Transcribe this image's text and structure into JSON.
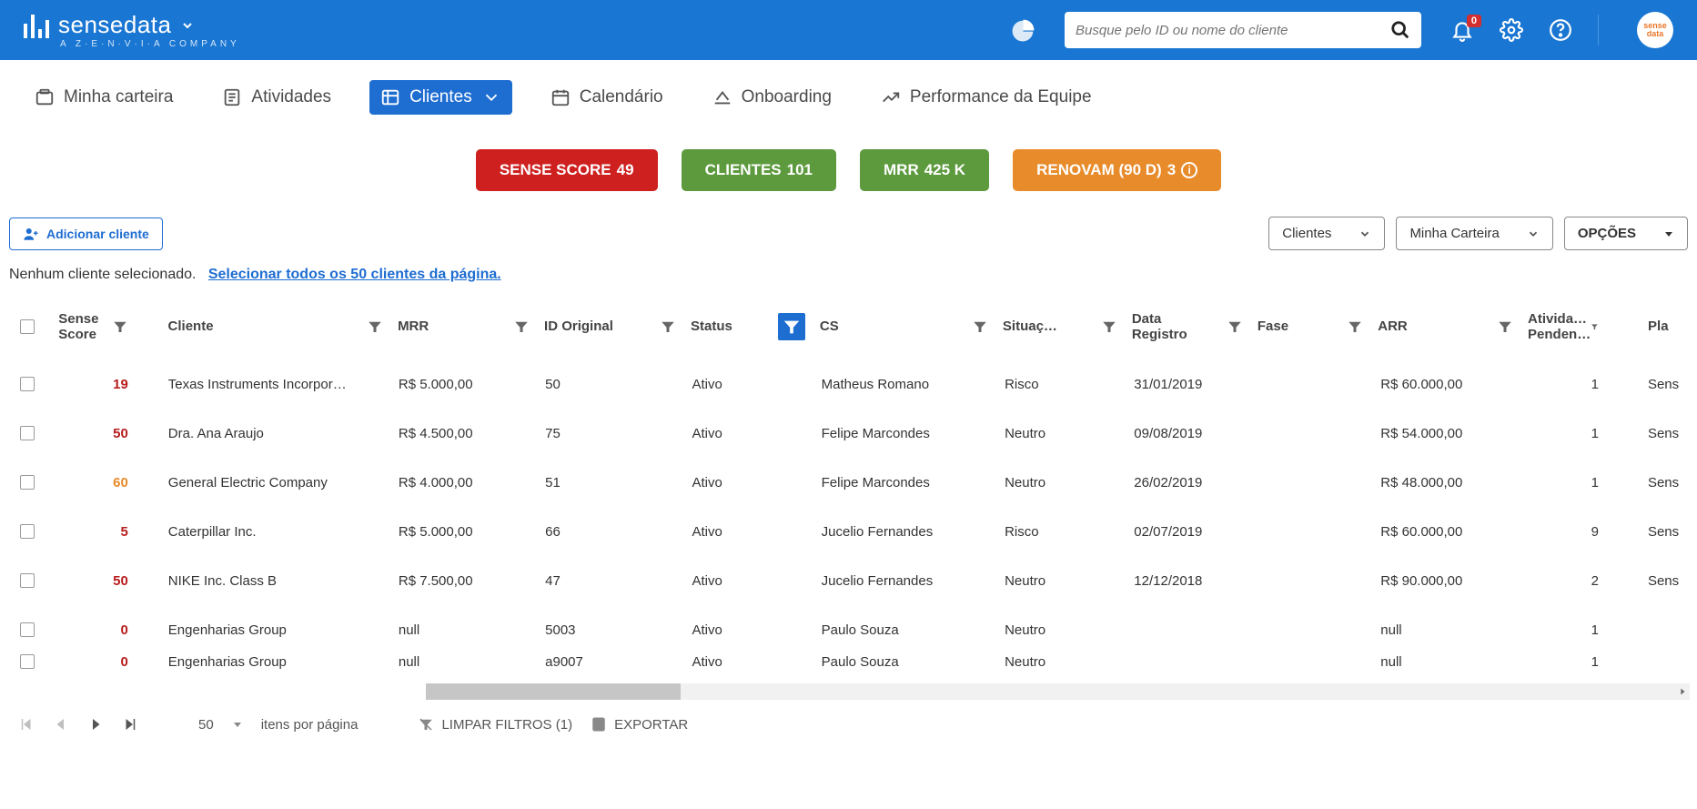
{
  "brand": {
    "name": "sensedata",
    "sub": "A  Z·E·N·V·I·A  COMPANY"
  },
  "search": {
    "placeholder": "Busque pelo ID ou nome do cliente"
  },
  "notification_count": "0",
  "nav": [
    {
      "label": "Minha carteira"
    },
    {
      "label": "Atividades"
    },
    {
      "label": "Clientes"
    },
    {
      "label": "Calendário"
    },
    {
      "label": "Onboarding"
    },
    {
      "label": "Performance da Equipe"
    }
  ],
  "metrics": {
    "sense_label": "SENSE SCORE",
    "sense_val": "49",
    "clientes_label": "CLIENTES",
    "clientes_val": "101",
    "mrr_label": "MRR",
    "mrr_val": "425 K",
    "renovam_label": "RENOVAM (90 D)",
    "renovam_val": "3"
  },
  "toolbar": {
    "add": "Adicionar cliente",
    "select_entity": "Clientes",
    "select_scope": "Minha Carteira",
    "options": "OPÇÕES"
  },
  "selection": {
    "none": "Nenhum cliente selecionado.",
    "all_link": "Selecionar todos os 50 clientes da página."
  },
  "columns": {
    "score": "Sense Score",
    "cliente": "Cliente",
    "mrr": "MRR",
    "id": "ID Original",
    "status": "Status",
    "cs": "CS",
    "sit": "Situaç…",
    "data": "Data Registro",
    "fase": "Fase",
    "arr": "ARR",
    "ativ": "Ativida… Penden…",
    "plat": "Pla"
  },
  "rows": [
    {
      "score": "19",
      "score_cls": "red",
      "cliente": "Texas Instruments Incorpor…",
      "mrr": "R$ 5.000,00",
      "id": "50",
      "status": "Ativo",
      "cs": "Matheus Romano",
      "sit": "Risco",
      "data": "31/01/2019",
      "fase": "",
      "arr": "R$ 60.000,00",
      "ativ": "1",
      "plat": "Sens"
    },
    {
      "score": "50",
      "score_cls": "red",
      "cliente": "Dra. Ana Araujo",
      "mrr": "R$ 4.500,00",
      "id": "75",
      "status": "Ativo",
      "cs": "Felipe Marcondes",
      "sit": "Neutro",
      "data": "09/08/2019",
      "fase": "",
      "arr": "R$ 54.000,00",
      "ativ": "1",
      "plat": "Sens"
    },
    {
      "score": "60",
      "score_cls": "orange",
      "cliente": "General Electric Company",
      "mrr": "R$ 4.000,00",
      "id": "51",
      "status": "Ativo",
      "cs": "Felipe Marcondes",
      "sit": "Neutro",
      "data": "26/02/2019",
      "fase": "",
      "arr": "R$ 48.000,00",
      "ativ": "1",
      "plat": "Sens"
    },
    {
      "score": "5",
      "score_cls": "red",
      "cliente": "Caterpillar Inc.",
      "mrr": "R$ 5.000,00",
      "id": "66",
      "status": "Ativo",
      "cs": "Jucelio Fernandes",
      "sit": "Risco",
      "data": "02/07/2019",
      "fase": "",
      "arr": "R$ 60.000,00",
      "ativ": "9",
      "plat": "Sens"
    },
    {
      "score": "50",
      "score_cls": "red",
      "cliente": "NIKE Inc. Class B",
      "mrr": "R$ 7.500,00",
      "id": "47",
      "status": "Ativo",
      "cs": "Jucelio Fernandes",
      "sit": "Neutro",
      "data": "12/12/2018",
      "fase": "",
      "arr": "R$ 90.000,00",
      "ativ": "2",
      "plat": "Sens"
    },
    {
      "score": "0",
      "score_cls": "red",
      "cliente": "Engenharias Group",
      "mrr": "null",
      "id": "5003",
      "status": "Ativo",
      "cs": "Paulo Souza",
      "sit": "Neutro",
      "data": "",
      "fase": "",
      "arr": "null",
      "ativ": "1",
      "plat": ""
    },
    {
      "score": "0",
      "score_cls": "red",
      "cliente": "Engenharias Group",
      "mrr": "null",
      "id": "a9007",
      "status": "Ativo",
      "cs": "Paulo Souza",
      "sit": "Neutro",
      "data": "",
      "fase": "",
      "arr": "null",
      "ativ": "1",
      "plat": ""
    }
  ],
  "footer": {
    "page_size": "50",
    "per_page": "itens por página",
    "clear": "LIMPAR FILTROS (1)",
    "export": "EXPORTAR"
  }
}
